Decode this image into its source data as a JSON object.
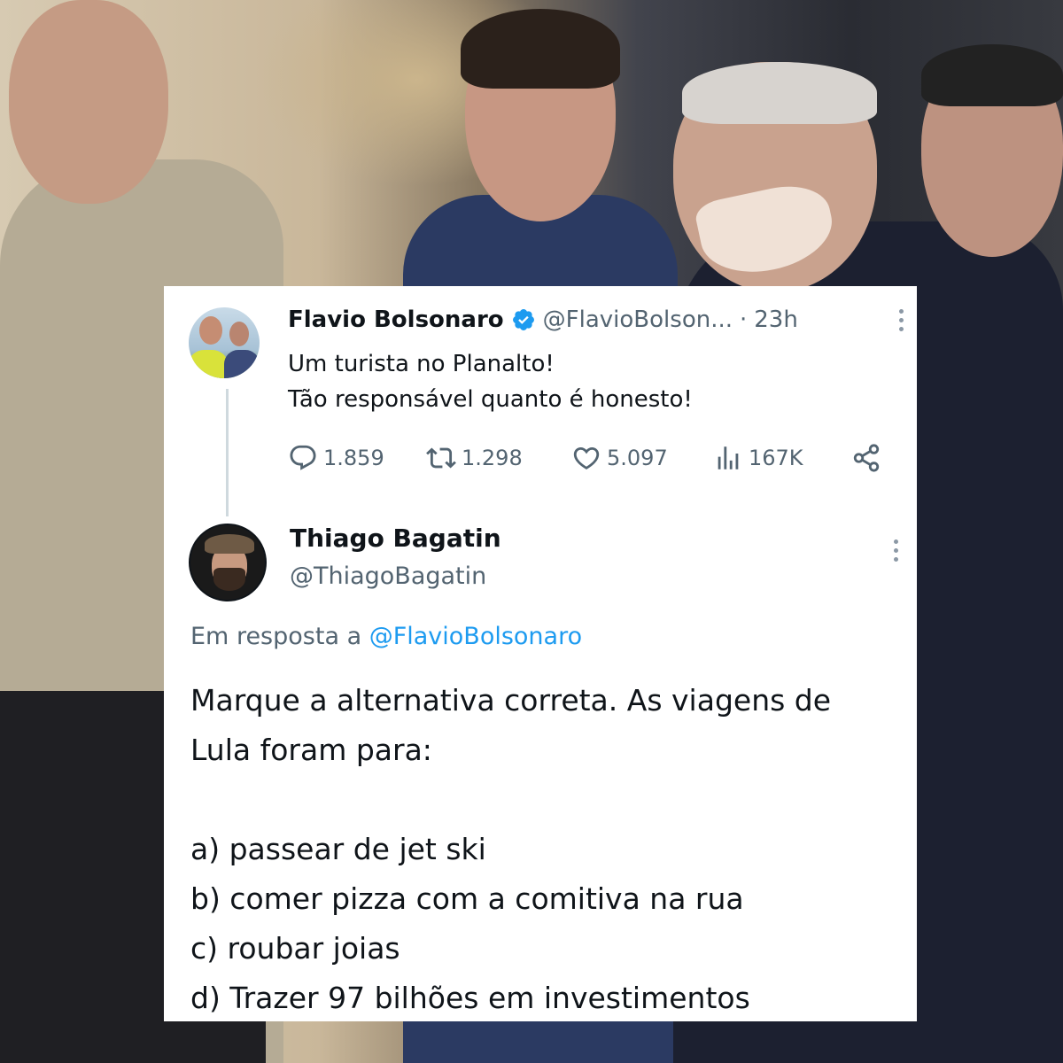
{
  "tweet1": {
    "author_name": "Flavio Bolsonaro",
    "handle": "@FlavioBolson...",
    "separator": "·",
    "time": "23h",
    "lines": [
      "Um turista no Planalto!",
      "Tão responsável quanto é honesto!"
    ],
    "stats": {
      "replies": "1.859",
      "retweets": "1.298",
      "likes": "5.097",
      "views": "167K"
    },
    "icons": [
      "verified-badge-icon",
      "reply-icon",
      "retweet-icon",
      "like-icon",
      "views-icon",
      "share-icon",
      "more-icon"
    ]
  },
  "tweet2": {
    "author_name": "Thiago Bagatin",
    "handle": "@ThiagoBagatin",
    "replying_prefix": "Em resposta a",
    "replying_mention": "@FlavioBolsonaro",
    "lines": [
      "Marque a alternativa correta. As viagens de",
      "Lula foram para:",
      "a) passear de jet ski",
      "b) comer pizza com a comitiva na rua",
      "c) roubar joias",
      "d) Trazer 97 bilhões em investimentos"
    ]
  },
  "colors": {
    "text": "#0f1419",
    "muted": "#536471",
    "link": "#1d9bf0",
    "verified": "#1d9bf0",
    "card": "#ffffff"
  }
}
